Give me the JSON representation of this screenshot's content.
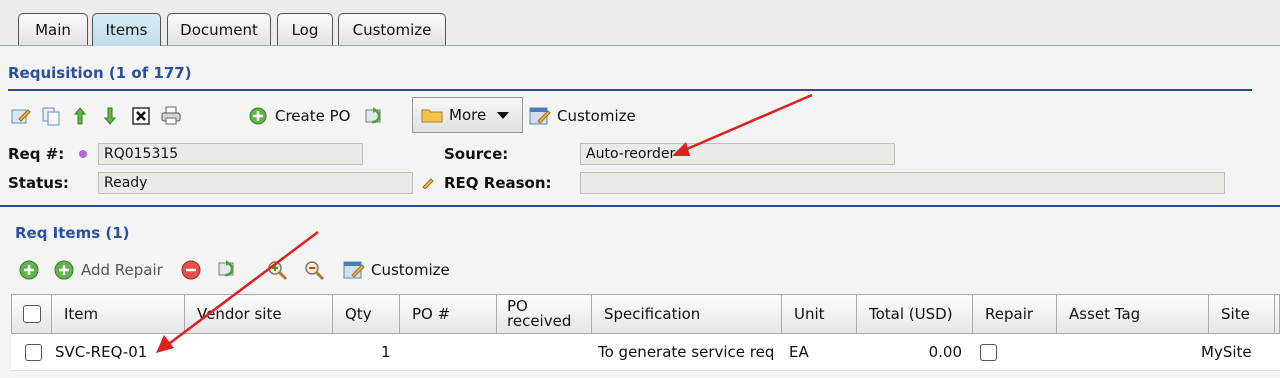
{
  "tabs": [
    {
      "label": "Main"
    },
    {
      "label": "Items",
      "active": true
    },
    {
      "label": "Document"
    },
    {
      "label": "Log"
    },
    {
      "label": "Customize"
    }
  ],
  "requisition": {
    "title": "Requisition (1 of 177)",
    "toolbar": {
      "create_po": "Create PO",
      "more": "More",
      "customize": "Customize"
    },
    "req_label": "Req #:",
    "req_value": "RQ015315",
    "source_label": "Source:",
    "source_value": "Auto-reorder",
    "status_label": "Status:",
    "status_value": "Ready",
    "reason_label": "REQ Reason:",
    "reason_value": ""
  },
  "items": {
    "title": "Req Items (1)",
    "toolbar": {
      "add_repair": "Add Repair",
      "customize": "Customize"
    },
    "columns": [
      "Item",
      "Vendor site",
      "Qty",
      "PO #",
      "PO received",
      "Specification",
      "Unit",
      "Total (USD)",
      "Repair",
      "Asset Tag",
      "Site"
    ],
    "rows": [
      {
        "item": "SVC-REQ-01",
        "vendor_site": "",
        "qty": "1",
        "po": "",
        "po_received": "",
        "specification": "To generate service req",
        "unit": "EA",
        "total": "0.00",
        "repair": false,
        "asset_tag": "",
        "site": "MySite"
      }
    ]
  },
  "colors": {
    "accent": "#2a4fa0",
    "annotation_arrow": "#e02020",
    "active_tab": "#c8e3ee"
  }
}
